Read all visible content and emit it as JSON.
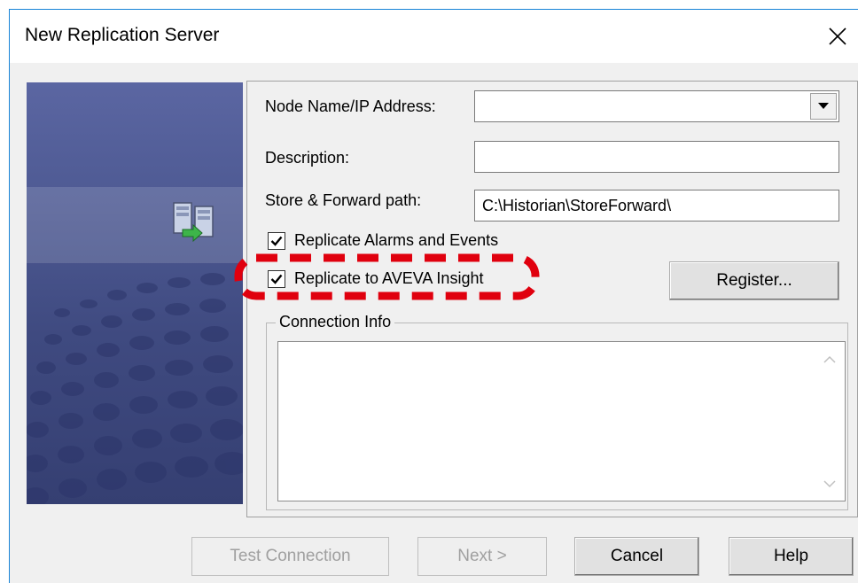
{
  "window": {
    "title": "New Replication Server",
    "close_icon": "close-icon"
  },
  "form": {
    "node_name_label": "Node Name/IP Address:",
    "node_name_value": "",
    "description_label": "Description:",
    "description_value": "",
    "store_forward_label": "Store & Forward path:",
    "store_forward_value": "C:\\Historian\\StoreForward\\",
    "replicate_alarms_label": "Replicate Alarms and Events",
    "replicate_alarms_checked": true,
    "replicate_insight_label": "Replicate to AVEVA Insight",
    "replicate_insight_checked": true,
    "register_button": "Register...",
    "connection_info_title": "Connection Info",
    "connection_info_value": ""
  },
  "buttons": {
    "test_connection": "Test Connection",
    "next": "Next >",
    "cancel": "Cancel",
    "help": "Help"
  },
  "colors": {
    "window_border": "#1883d7",
    "banner": "#4d5992",
    "highlight": "#e0000e",
    "disabled_text": "#a0a0a0"
  },
  "icons": [
    "close-icon",
    "server-replication-icon",
    "checkmark-icon",
    "dropdown-arrow-icon",
    "scroll-up-icon",
    "scroll-down-icon"
  ]
}
